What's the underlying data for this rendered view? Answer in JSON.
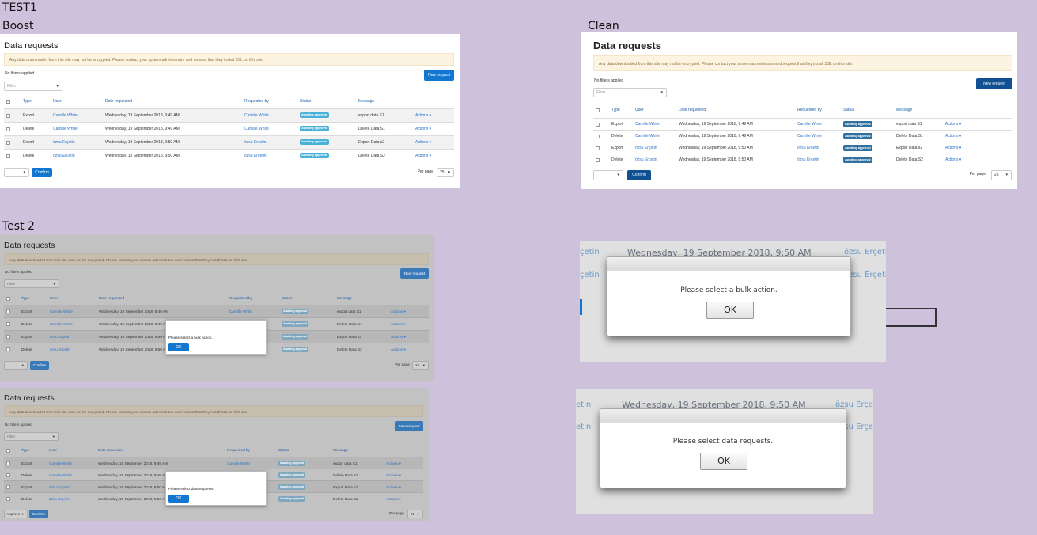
{
  "labels": {
    "test1": "TEST1",
    "boost": "Boost",
    "clean": "Clean",
    "test2": "Test 2"
  },
  "page": {
    "title": "Data requests",
    "alert": "Any data downloaded from this site may not be encrypted. Please contact your system administrator and request that they install SSL on this site.",
    "no_filters": "No filters applied",
    "new_request": "New request",
    "filter_placeholder": "Filter",
    "columns": [
      "Type",
      "User",
      "Date requested",
      "Requested by",
      "Status",
      "Message"
    ],
    "rows": [
      {
        "type": "Export",
        "user": "Camille White",
        "date": "Wednesday, 19 September 2018, 9:49 AM",
        "requested_by": "Camille White",
        "status": "Awaiting approval",
        "message": "export data S1"
      },
      {
        "type": "Delete",
        "user": "Camille White",
        "date": "Wednesday, 19 September 2018, 9:49 AM",
        "requested_by": "Camille White",
        "status": "Awaiting approval",
        "message": "Delete Data S1"
      },
      {
        "type": "Export",
        "user": "özsu Erçetin",
        "date": "Wednesday, 19 September 2018, 9:50 AM",
        "requested_by": "özsu Erçetin",
        "status": "Awaiting approval",
        "message": "Export Data s2"
      },
      {
        "type": "Delete",
        "user": "özsu Erçetin",
        "date": "Wednesday, 19 September 2018, 9:50 AM",
        "requested_by": "özsu Erçetin",
        "status": "Awaiting approval",
        "message": "Delete Data S2"
      }
    ],
    "actions": "Actions",
    "confirm": "Confirm",
    "per_page": "Per page",
    "per_page_value": "25",
    "bulk_approve": "Approve"
  },
  "dialogs": {
    "bulk_action": "Please select a bulk action.",
    "data_requests": "Please select data requests.",
    "ok": "OK"
  },
  "zoom_bg": {
    "date_row": "Wednesday, 19 September 2018, 9:50 AM",
    "user_fragment": "özsu Erçeti",
    "user_fragment2": "özsu Erçe",
    "left_fragment": "çetin",
    "left_fragment2": "etin"
  },
  "colors": {
    "background": "#cdc1dc",
    "primary": "#1177d1",
    "badge": "#4ab1d8",
    "alert_bg": "#fcf3e0"
  }
}
